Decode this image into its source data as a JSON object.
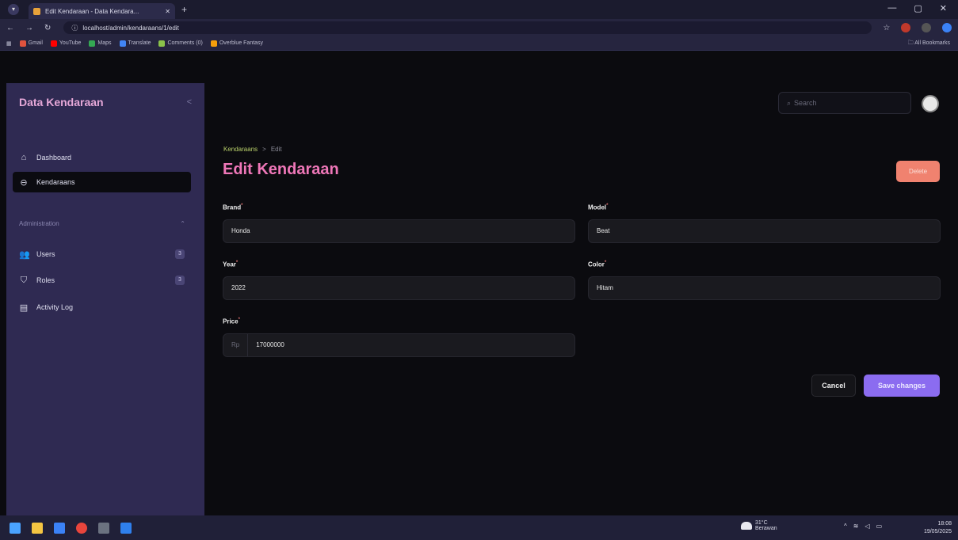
{
  "browser": {
    "tab_title": "Edit Kendaraan - Data Kendara...",
    "url": "localhost/admin/kendaraans/1/edit",
    "bookmarks": [
      "Gmail",
      "YouTube",
      "Maps",
      "Translate",
      "Comments (0)",
      "Overblue Fantasy"
    ],
    "all_bookmarks_label": "All Bookmarks"
  },
  "sidebar": {
    "app_title": "Data Kendaraan",
    "items": [
      {
        "label": "Dashboard",
        "icon": "home-icon"
      },
      {
        "label": "Kendaraans",
        "icon": "car-icon"
      }
    ],
    "group_label": "Administration",
    "admin_items": [
      {
        "label": "Users",
        "badge": "3",
        "icon": "users-icon"
      },
      {
        "label": "Roles",
        "badge": "3",
        "icon": "shield-icon"
      },
      {
        "label": "Activity Log",
        "icon": "log-icon"
      }
    ]
  },
  "topbar": {
    "search_placeholder": "Search"
  },
  "page": {
    "breadcrumb": [
      "Kendaraans",
      "Edit"
    ],
    "title": "Edit Kendaraan",
    "delete_label": "Delete"
  },
  "form": {
    "brand": {
      "label": "Brand",
      "value": "Honda"
    },
    "model": {
      "label": "Model",
      "value": "Beat"
    },
    "year": {
      "label": "Year",
      "value": "2022"
    },
    "color": {
      "label": "Color",
      "value": "Hitam"
    },
    "price": {
      "label": "Price",
      "prefix": "Rp",
      "value": "17000000"
    },
    "cancel_label": "Cancel",
    "save_label": "Save changes"
  },
  "taskbar": {
    "weather_temp": "31°C",
    "weather_text": "Berawan",
    "time": "18:08",
    "date": "19/05/2025"
  },
  "colors": {
    "accent": "#8b6cf0",
    "title": "#ef77b8",
    "danger": "#f0826f",
    "sidebar": "#2f2a52"
  }
}
